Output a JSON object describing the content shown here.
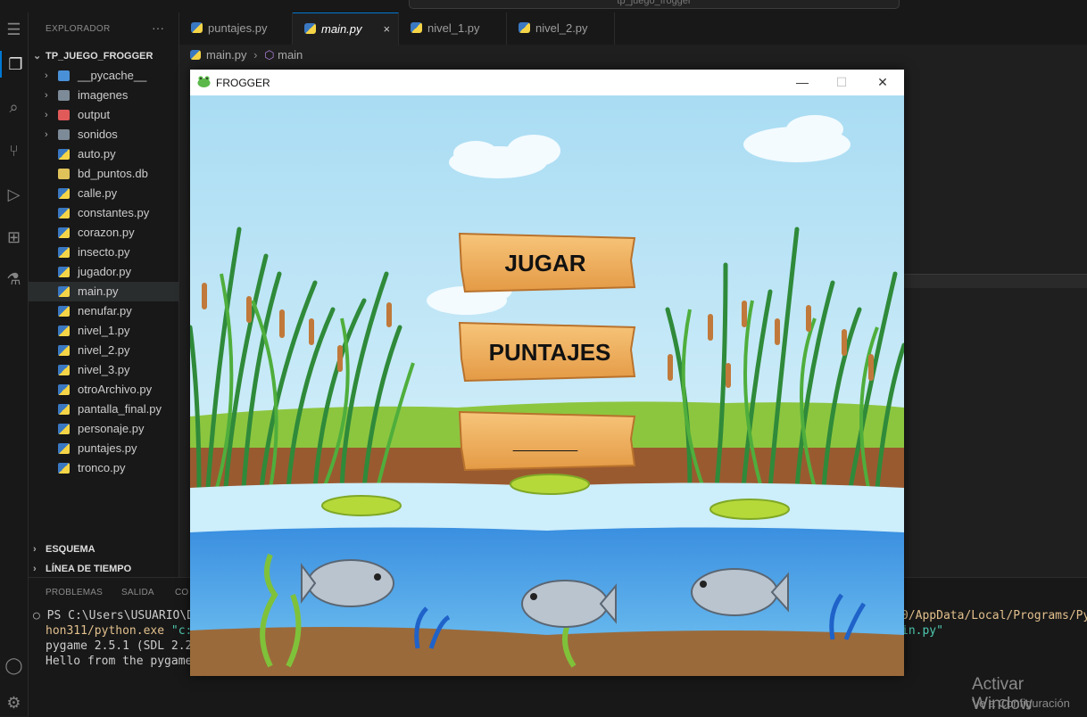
{
  "search": {
    "text": "tp_juego_frogger"
  },
  "explorer": {
    "header": "EXPLORADOR",
    "more": "···",
    "root": "TP_JUEGO_FROGGER",
    "items": [
      {
        "label": "__pycache__",
        "kind": "folder-blue",
        "folder": true
      },
      {
        "label": "imagenes",
        "kind": "folder",
        "folder": true
      },
      {
        "label": "output",
        "kind": "folder-red",
        "folder": true
      },
      {
        "label": "sonidos",
        "kind": "folder",
        "folder": true
      },
      {
        "label": "auto.py",
        "kind": "py"
      },
      {
        "label": "bd_puntos.db",
        "kind": "db"
      },
      {
        "label": "calle.py",
        "kind": "py"
      },
      {
        "label": "constantes.py",
        "kind": "py"
      },
      {
        "label": "corazon.py",
        "kind": "py"
      },
      {
        "label": "insecto.py",
        "kind": "py"
      },
      {
        "label": "jugador.py",
        "kind": "py"
      },
      {
        "label": "main.py",
        "kind": "py",
        "selected": true
      },
      {
        "label": "nenufar.py",
        "kind": "py"
      },
      {
        "label": "nivel_1.py",
        "kind": "py"
      },
      {
        "label": "nivel_2.py",
        "kind": "py"
      },
      {
        "label": "nivel_3.py",
        "kind": "py"
      },
      {
        "label": "otroArchivo.py",
        "kind": "py"
      },
      {
        "label": "pantalla_final.py",
        "kind": "py"
      },
      {
        "label": "personaje.py",
        "kind": "py"
      },
      {
        "label": "puntajes.py",
        "kind": "py"
      },
      {
        "label": "tronco.py",
        "kind": "py"
      }
    ],
    "outline": "ESQUEMA",
    "timeline": "LÍNEA DE TIEMPO"
  },
  "tabs": [
    {
      "label": "puntajes.py"
    },
    {
      "label": "main.py",
      "active": true,
      "close": "×"
    },
    {
      "label": "nivel_1.py"
    },
    {
      "label": "nivel_2.py"
    }
  ],
  "breadcrumb": {
    "file": "main.py",
    "symbol": "main"
  },
  "panel": {
    "tabs": [
      "PROBLEMAS",
      "SALIDA",
      "CO"
    ],
    "line1_prompt": "PS C:\\Users\\USUARIO\\D",
    "line1_right": "0/AppData/Local/Programs/Py",
    "line2_left": "hon311/python.exe ",
    "line2_str": "\"c:",
    "line2_right": "in.py\"",
    "line3": "pygame 2.5.1 (SDL 2.2",
    "line4": "Hello from the pygame"
  },
  "activate": {
    "line1": "Activar Window",
    "line2": "Ve a Configuración"
  },
  "game_window": {
    "title": "FROGGER",
    "minimize": "—",
    "maximize": "☐",
    "close": "✕",
    "buttons": {
      "play": "JUGAR",
      "scores": "PUNTAJES",
      "third": "_____"
    }
  }
}
